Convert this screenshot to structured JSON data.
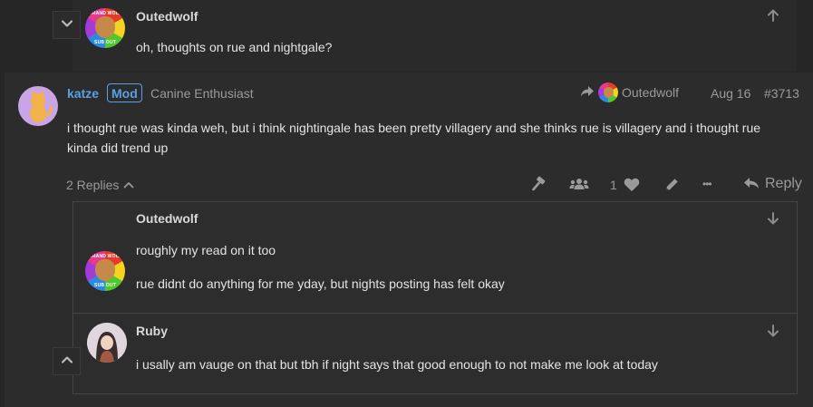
{
  "top_post": {
    "author": "Outedwolf",
    "body": "oh, thoughts on rue and nightgale?",
    "avatar_badge_top": "GRAND WOLF",
    "avatar_badge_bottom": "SUB OUT"
  },
  "main_post": {
    "author": "katze",
    "role_badge": "Mod",
    "user_title": "Canine Enthusiast",
    "reply_to_author": "Outedwolf",
    "date": "Aug 16",
    "post_number": "#3713",
    "body_line1": "i thought rue was kinda weh, but i think nightingale has been pretty villagery and she thinks rue is villagery and i thought rue",
    "body_line2": "kinda did trend up",
    "replies_label": "2 Replies",
    "like_count": "1",
    "more_label": "•••",
    "reply_label": "Reply"
  },
  "replies": [
    {
      "author": "Outedwolf",
      "line1": "roughly my read on it too",
      "line2": "rue didnt do anything for me yday, but nights posting has felt okay"
    },
    {
      "author": "Ruby",
      "line1": "i usally am vauge on that but tbh if night says that good enough to not make me look at today"
    }
  ],
  "colors": {
    "background": "#262626",
    "panel": "#2c2c2c",
    "accent_blue": "#5aa0e6",
    "muted": "#9a9a9a"
  },
  "icons": {
    "collapse": "chevron-down-icon",
    "expand": "chevron-up-icon",
    "share": "arrow-up-icon",
    "jump_down": "arrow-down-icon",
    "flag": "hammer-icon",
    "group": "users-icon",
    "like": "heart-icon",
    "edit": "pencil-icon",
    "reply": "reply-icon",
    "reply_to": "share-arrow-icon"
  }
}
